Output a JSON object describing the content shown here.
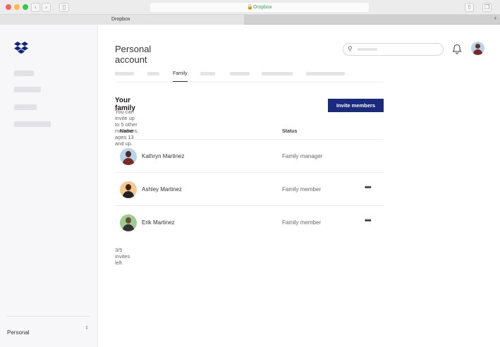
{
  "browser": {
    "url": "Dropbox",
    "tab": "Dropbox",
    "new_tab": "+"
  },
  "sidebar": {
    "account_switcher": "Personal",
    "switcher_icon": "updown-chevron-icon"
  },
  "header": {
    "title": "Personal account"
  },
  "tabs": {
    "active": "Family"
  },
  "family": {
    "heading": "Your family",
    "subtitle": "You can invite up to 5 other members, ages 13 and up.",
    "invite_label": "Invite members"
  },
  "table": {
    "headers": [
      "Name",
      "Status"
    ],
    "rows": [
      {
        "name": "Kathryn Martinez",
        "status": "Family manager",
        "avatar_color": "#b9d3ea"
      },
      {
        "name": "Ashley Martinez",
        "status": "Family member",
        "avatar_color": "#f6c98f",
        "more": "•••"
      },
      {
        "name": "Erik Martinez",
        "status": "Family member",
        "avatar_color": "#9ccc8e",
        "more": "•••"
      }
    ]
  },
  "invites_left": "3/5 invites left"
}
